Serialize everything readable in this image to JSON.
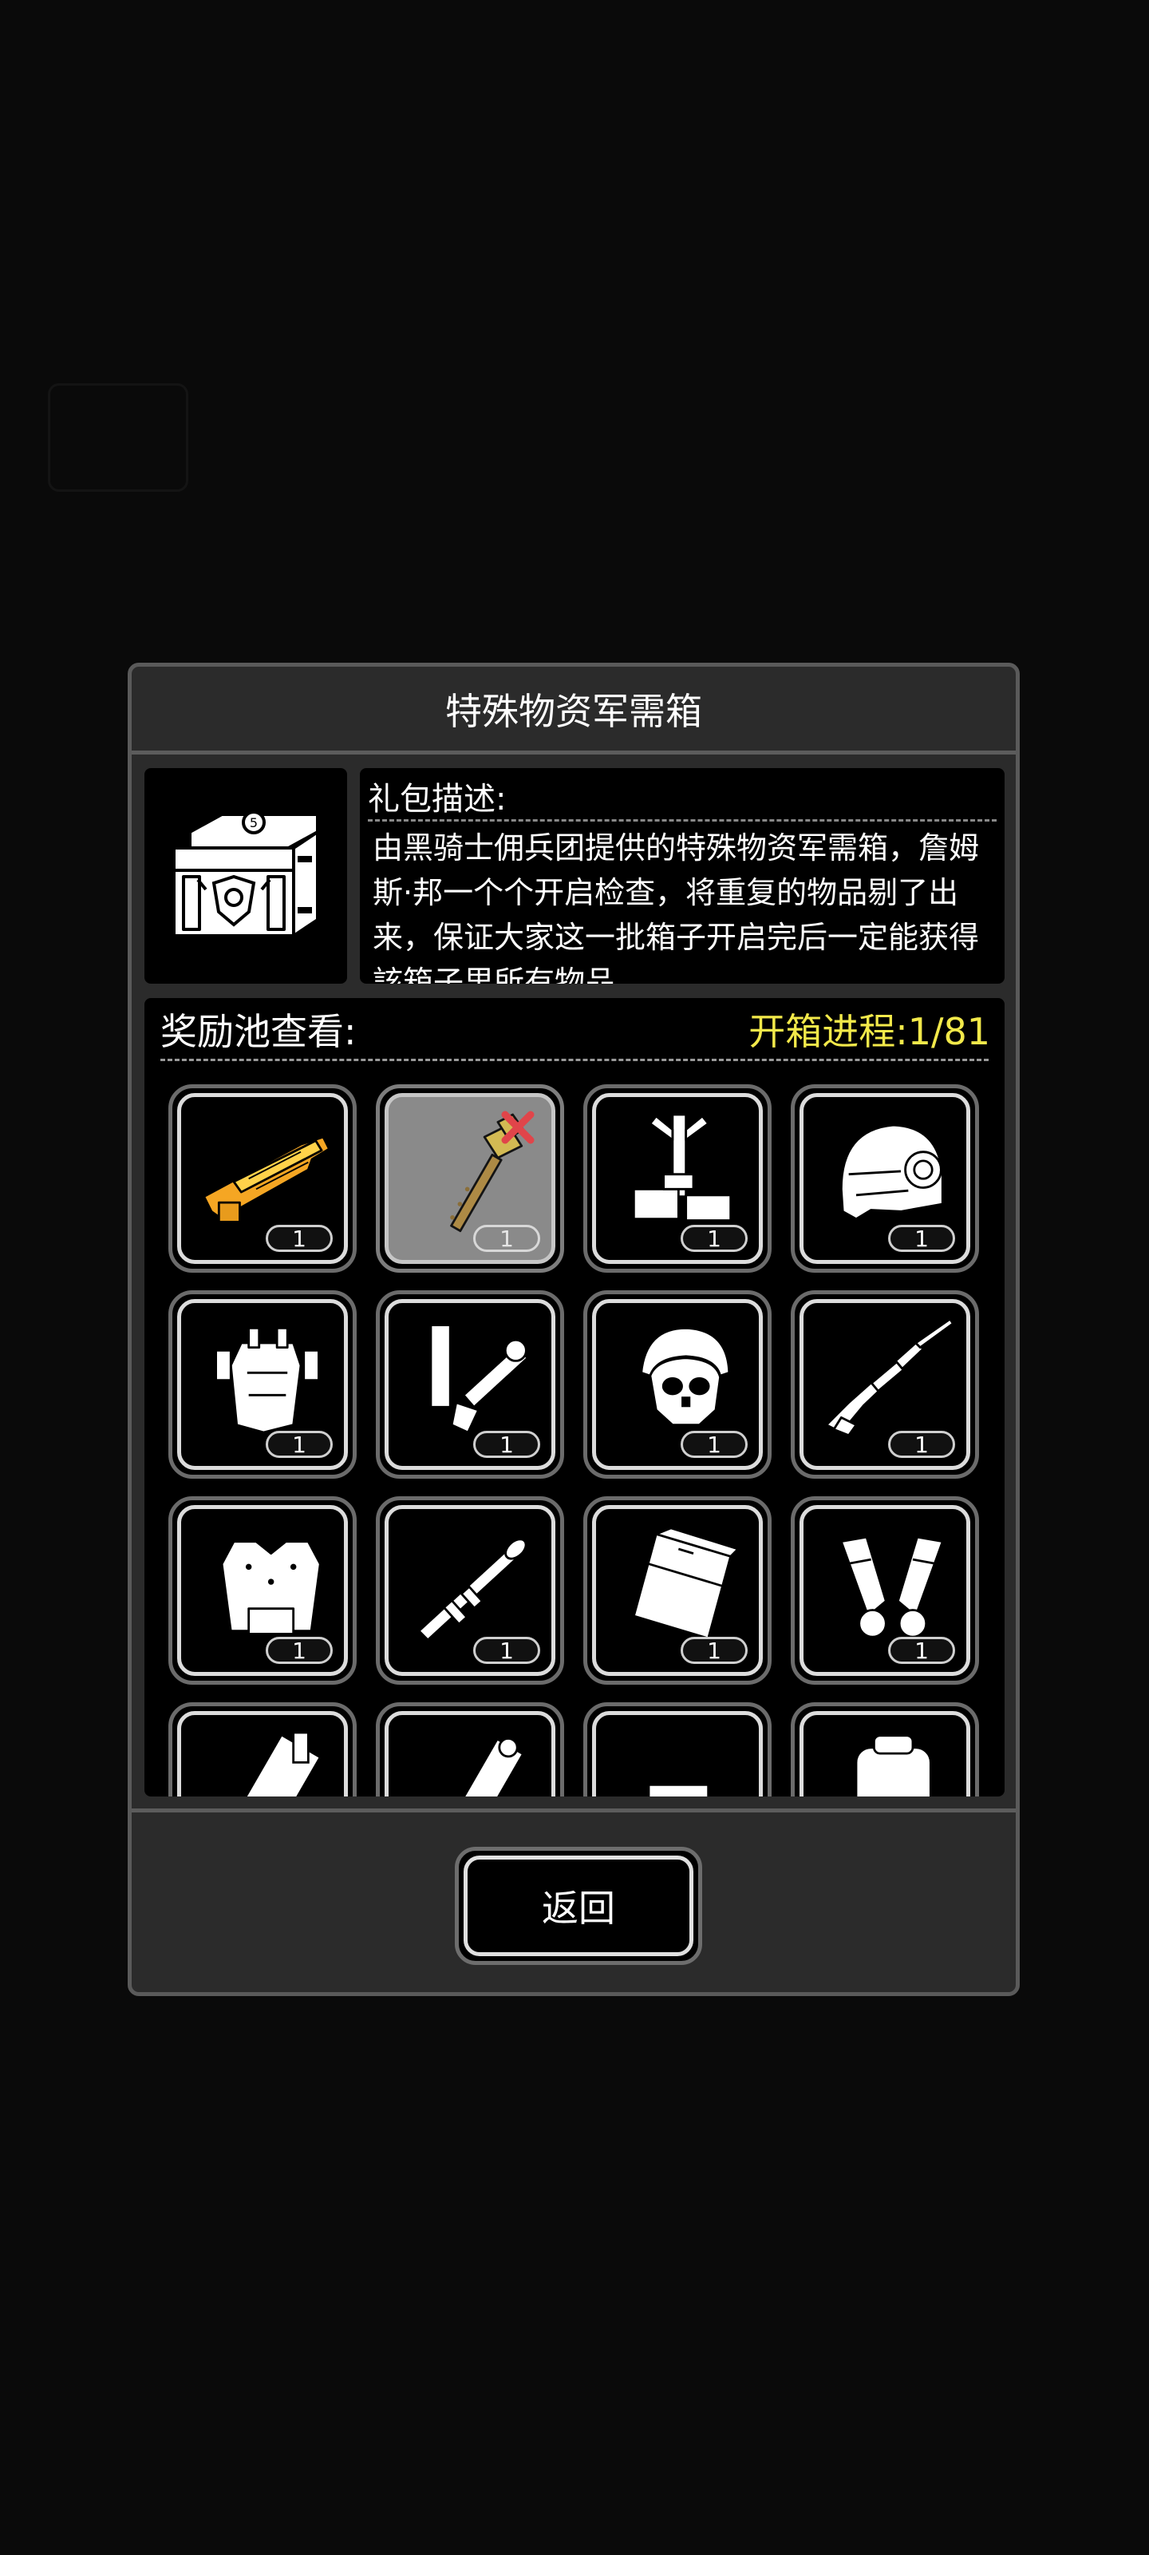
{
  "dialog": {
    "title": "特殊物资军需箱",
    "description_label": "礼包描述:",
    "description": "由黑骑士佣兵团提供的特殊物资军需箱，詹姆斯·邦一个个开启检查，将重复的物品剔了出来，保证大家这一批箱子开启完后一定能获得該箱子里所有物品",
    "reward_pool_label": "奖励池查看:",
    "progress_label": "开箱进程:",
    "progress_value": "1/81",
    "progress_fraction": 0.0123,
    "back_button": "返回"
  },
  "colors": {
    "accent_yellow": "#f2e94a",
    "panel_bg": "#2b2b2b",
    "panel_border": "#5a5a5a",
    "removed_mark": "#e0454a"
  },
  "items": [
    {
      "icon": "golden-rifle-icon",
      "count": "1",
      "opened": false
    },
    {
      "icon": "golden-hammer-icon",
      "count": "1",
      "opened": true
    },
    {
      "icon": "tripod-tool-kit-icon",
      "count": "1",
      "opened": false
    },
    {
      "icon": "tactical-helmet-icon",
      "count": "1",
      "opened": false
    },
    {
      "icon": "body-armor-rig-icon",
      "count": "1",
      "opened": false
    },
    {
      "icon": "launcher-arm-icon",
      "count": "1",
      "opened": false
    },
    {
      "icon": "skull-helmet-icon",
      "count": "1",
      "opened": false
    },
    {
      "icon": "sniper-rifle-icon",
      "count": "1",
      "opened": false
    },
    {
      "icon": "armored-vest-icon",
      "count": "1",
      "opened": false
    },
    {
      "icon": "rpg-launcher-icon",
      "count": "1",
      "opened": false
    },
    {
      "icon": "ammo-case-icon",
      "count": "1",
      "opened": false
    },
    {
      "icon": "gauntlets-icon",
      "count": "1",
      "opened": false
    },
    {
      "icon": "minigun-icon",
      "count": "",
      "opened": false
    },
    {
      "icon": "spiked-club-icon",
      "count": "",
      "opened": false
    },
    {
      "icon": "heavy-rifle-icon",
      "count": "",
      "opened": false
    },
    {
      "icon": "backpack-icon",
      "count": "",
      "opened": false
    }
  ]
}
